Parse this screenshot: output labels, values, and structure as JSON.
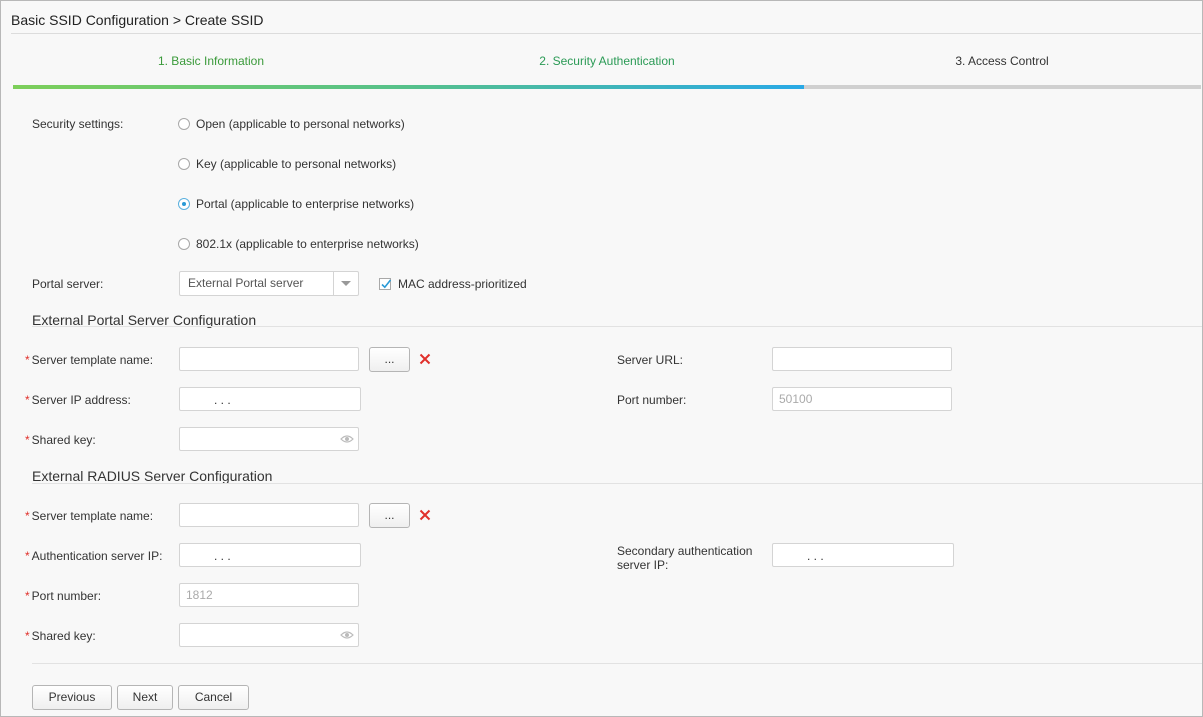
{
  "breadcrumb": "Basic SSID Configuration > Create SSID",
  "steps": [
    {
      "label": "1. Basic Information",
      "state": "done"
    },
    {
      "label": "2. Security Authentication",
      "state": "active"
    },
    {
      "label": "3. Access Control",
      "state": "todo"
    }
  ],
  "progress_fraction": 0.667,
  "security": {
    "label": "Security settings:",
    "options": [
      {
        "label": "Open (applicable to personal networks)",
        "selected": false
      },
      {
        "label": "Key (applicable to personal networks)",
        "selected": false
      },
      {
        "label": "Portal (applicable to enterprise networks)",
        "selected": true
      },
      {
        "label": "802.1x (applicable to enterprise networks)",
        "selected": false
      }
    ]
  },
  "portal": {
    "label": "Portal server:",
    "selected": "External Portal server",
    "mac_label": "MAC address-prioritized",
    "mac_checked": true
  },
  "external_portal": {
    "title": "External Portal Server Configuration",
    "template_label": "Server template name:",
    "ip_label": "Server IP address:",
    "key_label": "Shared key:",
    "url_label": "Server URL:",
    "port_label": "Port number:",
    "port_placeholder": "50100",
    "browse_label": "..."
  },
  "external_radius": {
    "title": "External RADIUS Server Configuration",
    "template_label": "Server template name:",
    "auth_ip_label": "Authentication server IP:",
    "port_label": "Port number:",
    "port_placeholder": "1812",
    "key_label": "Shared key:",
    "secondary_label": "Secondary authentication server IP:",
    "browse_label": "..."
  },
  "ip_dots": ".          .          .",
  "required_mark": "*",
  "buttons": {
    "previous": "Previous",
    "next": "Next",
    "cancel": "Cancel"
  },
  "colors": {
    "accent": "#2a9ad6",
    "step_done": "#3a9a3a",
    "required": "#e0302b",
    "delete": "#e0302b"
  }
}
